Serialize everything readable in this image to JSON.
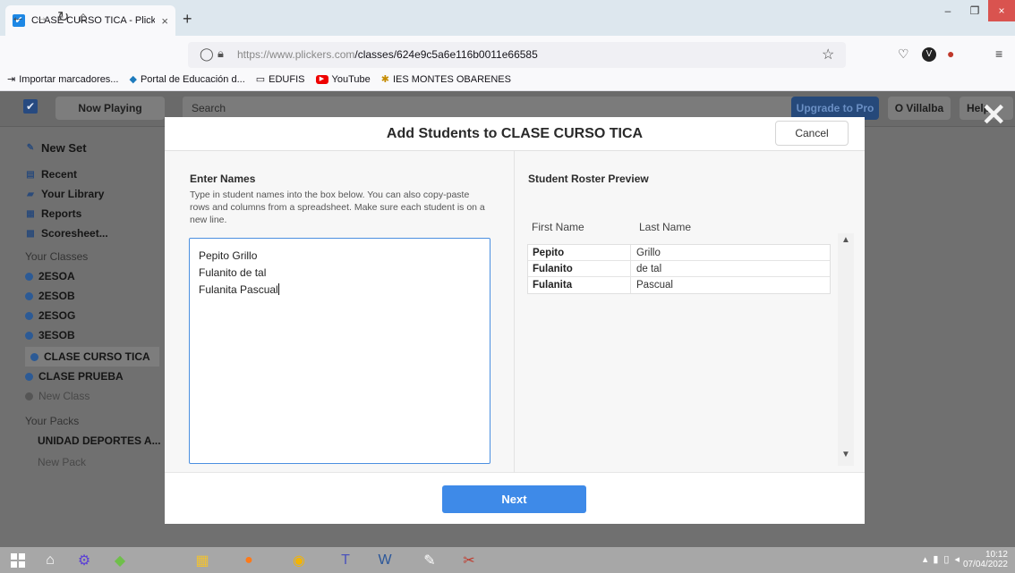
{
  "browser": {
    "tab_title": "CLASE CURSO TICA - Plickers",
    "tab_close": "×",
    "new_tab": "+",
    "url_host": "https://www.plickers.com",
    "url_path": "/classes/624e9c5a6e116b0011e66585",
    "window_controls": {
      "minimize": "–",
      "maximize": "❐",
      "close": "×"
    },
    "bookmarks": [
      {
        "label": "Importar marcadores...",
        "icon": "import-icon"
      },
      {
        "label": "Portal de Educación d...",
        "icon": "portal-icon"
      },
      {
        "label": "EDUFIS",
        "icon": "folder-icon"
      },
      {
        "label": "YouTube",
        "icon": "youtube-icon"
      },
      {
        "label": "IES MONTES OBARENES",
        "icon": "school-icon"
      }
    ]
  },
  "app": {
    "now_playing": "Now Playing",
    "search_label": "Search",
    "upgrade_label": "Upgrade to Pro",
    "user_label": "O Villalba",
    "help_label": "Help",
    "close_overlay": "✕",
    "sidebar": {
      "new_set": "New Set",
      "nav": [
        "Recent",
        "Your Library",
        "Reports",
        "Scoresheet..."
      ],
      "classes_heading": "Your Classes",
      "classes": [
        "2ESOA",
        "2ESOB",
        "2ESOG",
        "3ESOB",
        "CLASE CURSO TICA",
        "CLASE PRUEBA"
      ],
      "new_class": "New Class",
      "packs_heading": "Your Packs",
      "packs": [
        "UNIDAD DEPORTES A..."
      ],
      "new_pack": "New Pack"
    }
  },
  "modal": {
    "title": "Add Students to CLASE CURSO TICA",
    "cancel_label": "Cancel",
    "enter_label": "Enter Names",
    "help_text": "Type in student names into the box below. You can also copy-paste rows and columns from a spreadsheet. Make sure each student is on a new line.",
    "names": [
      "Pepito Grillo",
      "Fulanito de tal",
      "Fulanita Pascual"
    ],
    "roster_label": "Student Roster Preview",
    "col_first": "First Name",
    "col_last": "Last Name",
    "roster": [
      {
        "first": "Pepito",
        "last": "Grillo"
      },
      {
        "first": "Fulanito",
        "last": "de tal"
      },
      {
        "first": "Fulanita",
        "last": "Pascual"
      }
    ],
    "next_label": "Next"
  },
  "taskbar": {
    "time": "10:12",
    "date": "07/04/2022"
  },
  "colors": {
    "accent": "#3e8ae8",
    "upgrade": "#26497a",
    "class_dot": "#2c5a95"
  }
}
